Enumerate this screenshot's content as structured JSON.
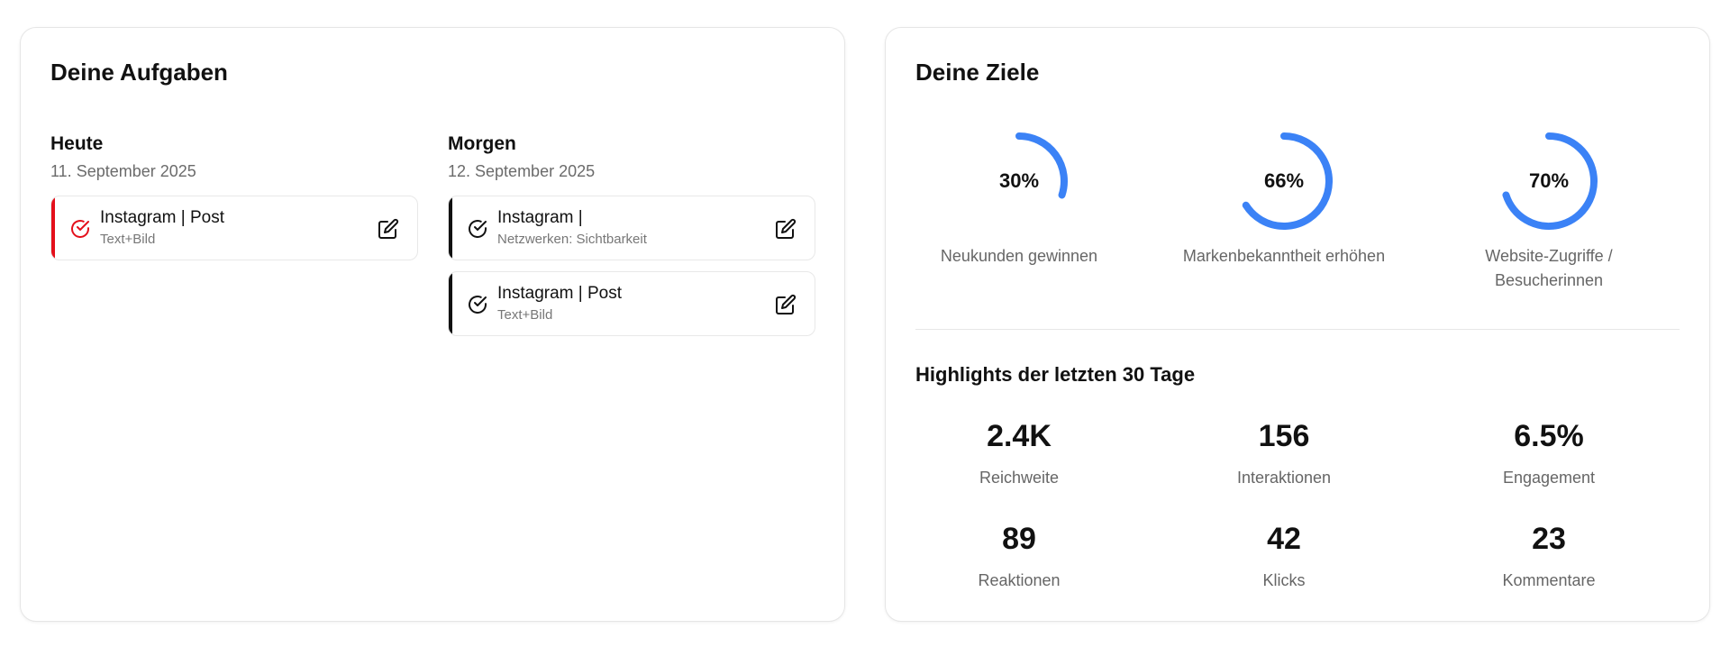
{
  "tasks": {
    "title": "Deine Aufgaben",
    "today": {
      "title": "Heute",
      "date": "11. September 2025",
      "items": [
        {
          "name": "Instagram | Post",
          "sub": "Text+Bild"
        }
      ]
    },
    "tomorrow": {
      "title": "Morgen",
      "date": "12. September 2025",
      "items": [
        {
          "name": "Instagram |",
          "sub": "Netzwerken: Sichtbarkeit"
        },
        {
          "name": "Instagram | Post",
          "sub": "Text+Bild"
        }
      ]
    }
  },
  "goals": {
    "title": "Deine Ziele",
    "items": [
      {
        "percent_label": "30%",
        "value": 30,
        "label": "Neukunden gewinnen"
      },
      {
        "percent_label": "66%",
        "value": 66,
        "label": "Markenbekanntheit erhöhen"
      },
      {
        "percent_label": "70%",
        "value": 70,
        "label": "Website-Zugriffe / Besucherinnen"
      }
    ]
  },
  "highlights": {
    "title": "Highlights der letzten 30 Tage",
    "metrics": [
      {
        "value": "2.4K",
        "label": "Reichweite"
      },
      {
        "value": "156",
        "label": "Interaktionen"
      },
      {
        "value": "6.5%",
        "label": "Engagement"
      },
      {
        "value": "89",
        "label": "Reaktionen"
      },
      {
        "value": "42",
        "label": "Klicks"
      },
      {
        "value": "23",
        "label": "Kommentare"
      }
    ]
  },
  "colors": {
    "accent": "#3b82f6",
    "urgent": "#e4101b",
    "text": "#111111",
    "muted": "#6b6b6b"
  },
  "icons": {
    "check": "check-circle-icon",
    "edit": "edit-pencil-icon"
  }
}
